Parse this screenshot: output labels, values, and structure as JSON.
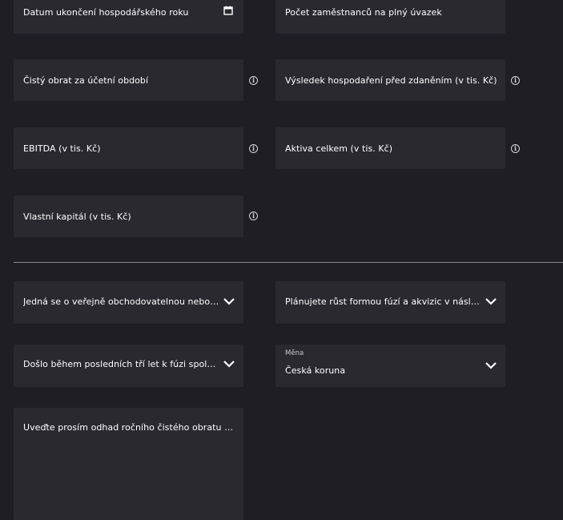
{
  "fields": {
    "end_date": "Datum ukončení hospodářského roku",
    "employees": "Počet zaměstnanců na plný úvazek",
    "net_turnover": "Čistý obrat za účetní období",
    "pre_tax_result": "Výsledek hospodaření před zdaněním (v tis. Kč)",
    "ebitda": "EBITDA (v tis. Kč)",
    "total_assets": "Aktiva celkem (v tis. Kč)",
    "equity": "Vlastní kapitál (v tis. Kč)"
  },
  "dropdowns": {
    "public_company": "Jedná se o veřejně obchodovatelnou nebo so...",
    "growth_mna": "Plánujete růst formou fúzí a akvizic v následu...",
    "recent_merger": "Došlo během posledních tří let k fúzi společno...",
    "currency_label": "Měna",
    "currency_value": "Česká koruna"
  },
  "textarea": {
    "estimate": "Uveďte prosím odhad ročního čistého obratu a v..."
  },
  "icons": {
    "info": "i"
  }
}
